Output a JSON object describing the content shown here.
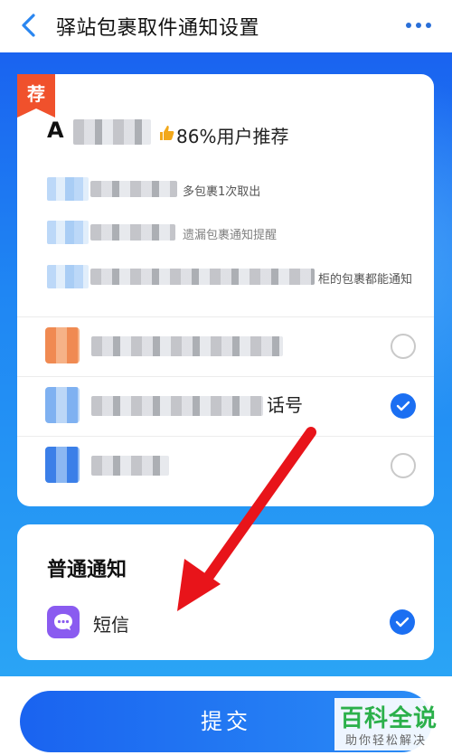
{
  "header": {
    "title": "驿站包裹取件通知设置",
    "back_icon": "chevron-left-icon",
    "more_icon": "more-dots-icon"
  },
  "recommended_card": {
    "badge": "荐",
    "app_name_visible": "A",
    "recommend_text": "86%用户推荐",
    "features": [
      {
        "text": "多包裹1次取出"
      },
      {
        "text": "遗漏包裹通知提醒"
      },
      {
        "text": "柜的包裹都能通知"
      }
    ],
    "options": [
      {
        "suffix": "",
        "checked": false
      },
      {
        "suffix": "话号",
        "checked": true
      },
      {
        "suffix": "",
        "checked": false
      }
    ]
  },
  "normal_card": {
    "title": "普通通知",
    "sms_label": "短信",
    "sms_checked": true
  },
  "submit_label": "提交",
  "watermark": {
    "main": "百科全说",
    "sub": "助你轻松解决"
  },
  "colors": {
    "accent": "#1b6ff2",
    "badge": "#f0512c",
    "sms": "#8a5bf0",
    "arrow": "#e8141a"
  }
}
